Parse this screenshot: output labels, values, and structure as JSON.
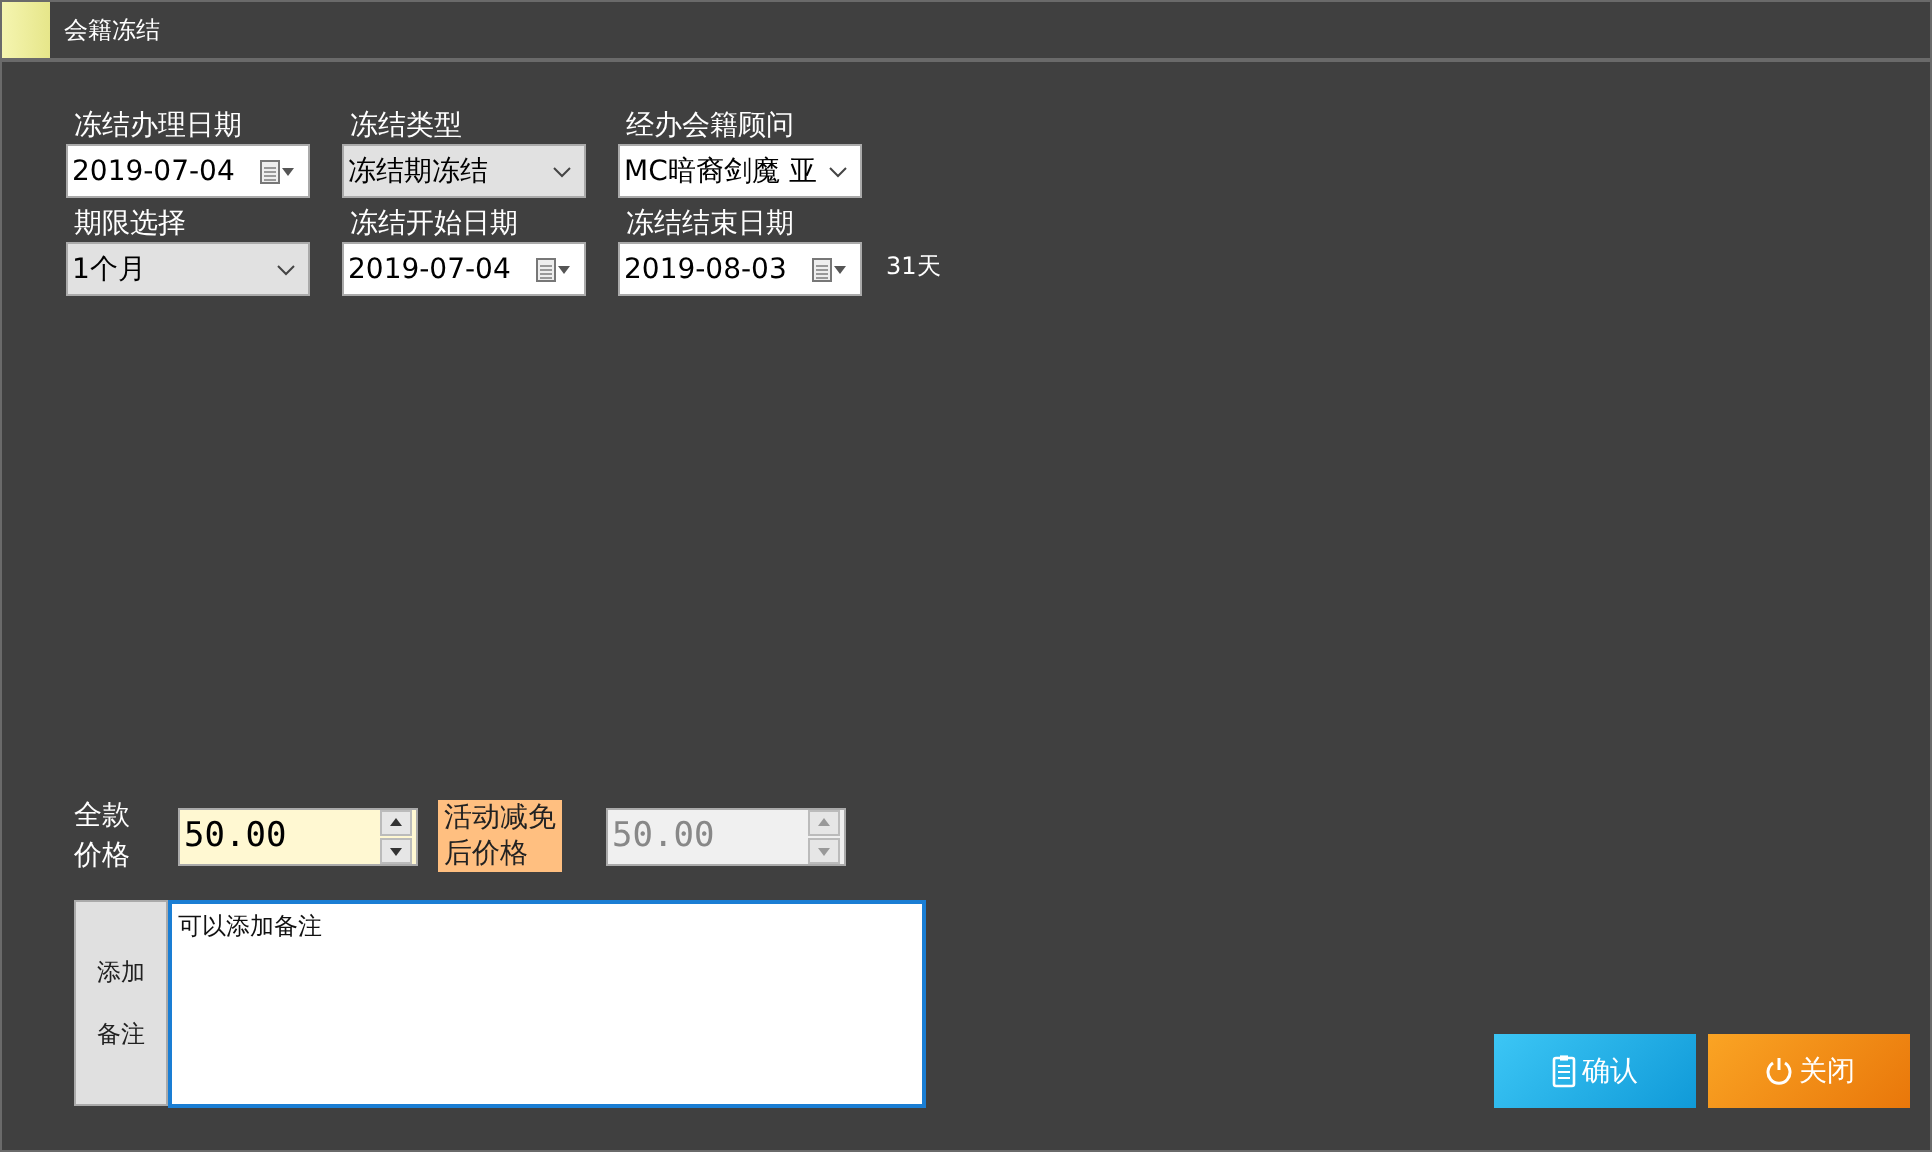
{
  "window": {
    "title": "会籍冻结"
  },
  "rows": [
    [
      {
        "label": "冻结办理日期",
        "kind": "date",
        "value": "2019-07-04"
      },
      {
        "label": "冻结类型",
        "kind": "dropdown",
        "value": "冻结期冻结"
      },
      {
        "label": "经办会籍顾问",
        "kind": "combo",
        "value": "MC暗裔剑魔 亚"
      }
    ],
    [
      {
        "label": "期限选择",
        "kind": "dropdown",
        "value": "1个月"
      },
      {
        "label": "冻结开始日期",
        "kind": "date",
        "value": "2019-07-04"
      },
      {
        "label": "冻结结束日期",
        "kind": "date",
        "value": "2019-08-03"
      }
    ]
  ],
  "duration": "31天",
  "full_price": {
    "label_lines": [
      "全款",
      "价格"
    ],
    "value": "50.00",
    "disabled": false
  },
  "discount_price": {
    "label_lines": [
      "活动减免",
      "后价格"
    ],
    "value": "50.00",
    "disabled": true
  },
  "notes": {
    "button_lines": [
      "添加",
      "备注"
    ],
    "value": "可以添加备注"
  },
  "buttons": [
    {
      "label": "确认",
      "kind": "confirm"
    },
    {
      "label": "关闭",
      "kind": "close"
    }
  ]
}
